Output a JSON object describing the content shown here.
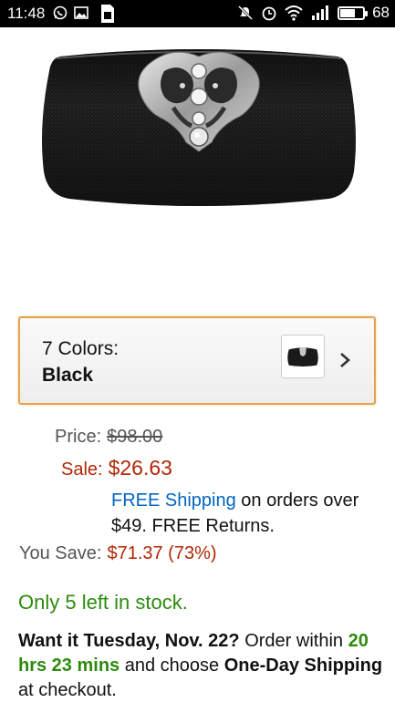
{
  "status_bar": {
    "time": "11:48",
    "battery_level": "68",
    "battery_fraction": 0.68,
    "left_icons": [
      "whatsapp-icon",
      "image-icon",
      "sim-icon"
    ],
    "right_icons": [
      "mute-icon",
      "alarm-icon",
      "wifi-icon",
      "signal-icon",
      "battery-icon"
    ]
  },
  "product": {
    "image": "black-clutch-bag-with-crystal-clasp"
  },
  "color_selector": {
    "count_label": "7 Colors:",
    "selected": "Black"
  },
  "pricing": {
    "list_label": "Price:",
    "list_price": "$98.00",
    "sale_label": "Sale:",
    "sale_price": "$26.63",
    "shipping_link": "FREE Shipping",
    "shipping_rest": " on orders over $49. FREE Returns.",
    "save_label": "You Save:",
    "save_value": "$71.37 (73%)"
  },
  "stock": "Only 5 left in stock.",
  "delivery": {
    "want_it": "Want it Tuesday, Nov. 22?",
    "order_within": " Order within ",
    "countdown": "20 hrs 23 mins",
    "choose": " and choose ",
    "one_day": "One-Day Shipping",
    "checkout": " at checkout."
  },
  "colors": {
    "accent_border": "#e7a34a",
    "price_red": "#b12704",
    "link_blue": "#0066c0",
    "stock_green": "#2d8b0e"
  }
}
